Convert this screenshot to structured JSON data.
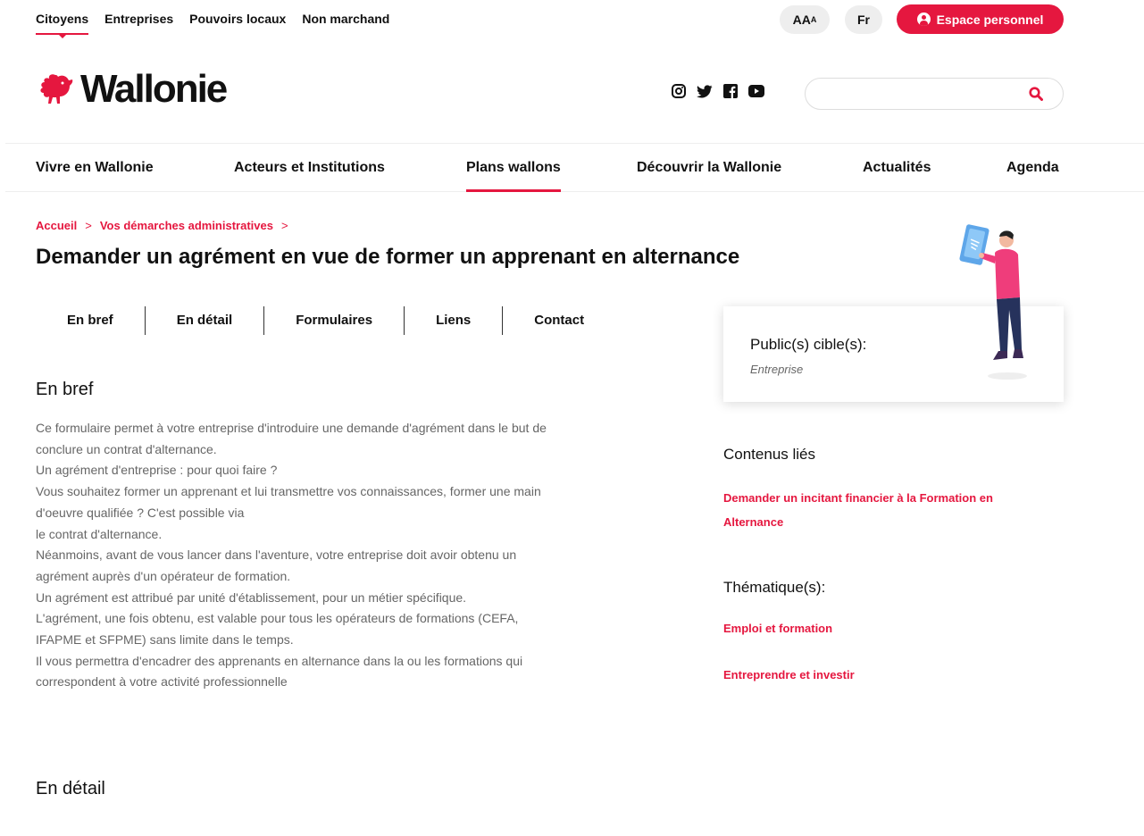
{
  "topbar": {
    "audience": [
      "Citoyens",
      "Entreprises",
      "Pouvoirs locaux",
      "Non marchand"
    ],
    "font_size_label": "AA",
    "font_size_small": "A",
    "language": "Fr",
    "espace_personnel": "Espace personnel"
  },
  "header": {
    "logo_text": "Wallonie",
    "socials": [
      "instagram-icon",
      "twitter-icon",
      "facebook-icon",
      "youtube-icon"
    ],
    "search_placeholder": ""
  },
  "nav": {
    "items": [
      "Vivre en Wallonie",
      "Acteurs et Institutions",
      "Plans wallons",
      "Découvrir la Wallonie",
      "Actualités",
      "Agenda"
    ]
  },
  "breadcrumb": {
    "items": [
      "Accueil",
      "Vos démarches administratives"
    ],
    "separator": ">"
  },
  "page": {
    "title": "Demander un agrément en vue de former un apprenant en alternance"
  },
  "tabs": [
    "En bref",
    "En détail",
    "Formulaires",
    "Liens",
    "Contact"
  ],
  "content": {
    "en_bref_title": "En bref",
    "en_bref_lines": [
      "Ce formulaire permet à votre entreprise d'introduire une demande d'agrément dans le but de",
      "conclure un contrat d'alternance.",
      "Un agrément d'entreprise : pour quoi faire ?",
      "Vous souhaitez former un apprenant et lui transmettre vos connaissances, former une main",
      "d'oeuvre qualifiée ? C'est possible via",
      "le contrat d'alternance.",
      "Néanmoins, avant de vous lancer dans l'aventure, votre entreprise doit avoir obtenu un",
      "agrément auprès d'un opérateur de formation.",
      "Un agrément est attribué par unité d'établissement, pour un métier spécifique.",
      "L'agrément, une fois obtenu, est valable pour tous les opérateurs de formations (CEFA,",
      "IFAPME et SFPME) sans limite dans le temps.",
      "Il vous permettra d'encadrer des apprenants en alternance dans la ou les formations qui",
      "correspondent à votre activité professionnelle"
    ],
    "en_detail_title": "En détail"
  },
  "sidebar": {
    "public_title": "Public(s) cible(s):",
    "public_value": "Entreprise",
    "contenus_title": "Contenus liés",
    "contenus_links": [
      "Demander un incitant financier à la Formation en Alternance"
    ],
    "thematique_title": "Thématique(s):",
    "thematique_links": [
      "Emploi et formation",
      "Entreprendre et investir"
    ]
  },
  "colors": {
    "accent": "#e5173f",
    "text": "#111111",
    "muted": "#666666"
  }
}
